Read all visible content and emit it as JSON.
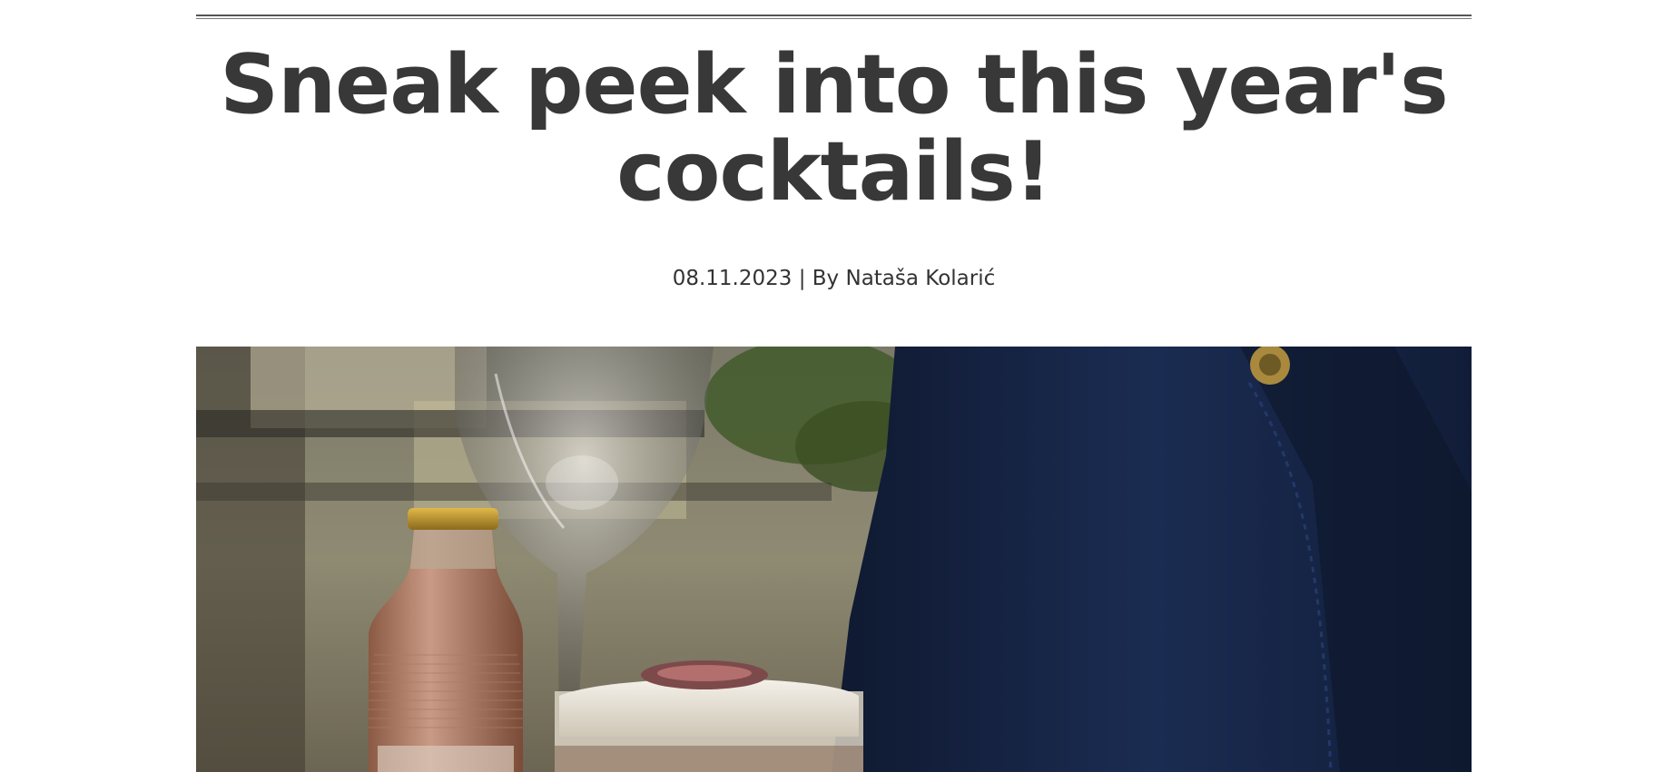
{
  "article": {
    "title": "Sneak peek into this year's cocktails!",
    "date": "08.11.2023",
    "separator": "|",
    "byline": "By Nataša Kolarić"
  },
  "hero_image": {
    "subject": "cocktail bottle, champagne glass and fig-topped drink beside a person in a navy jacket"
  },
  "colors": {
    "title": "#383838",
    "meta": "#333333",
    "rule": "#555555",
    "jacket": "#15223f"
  }
}
